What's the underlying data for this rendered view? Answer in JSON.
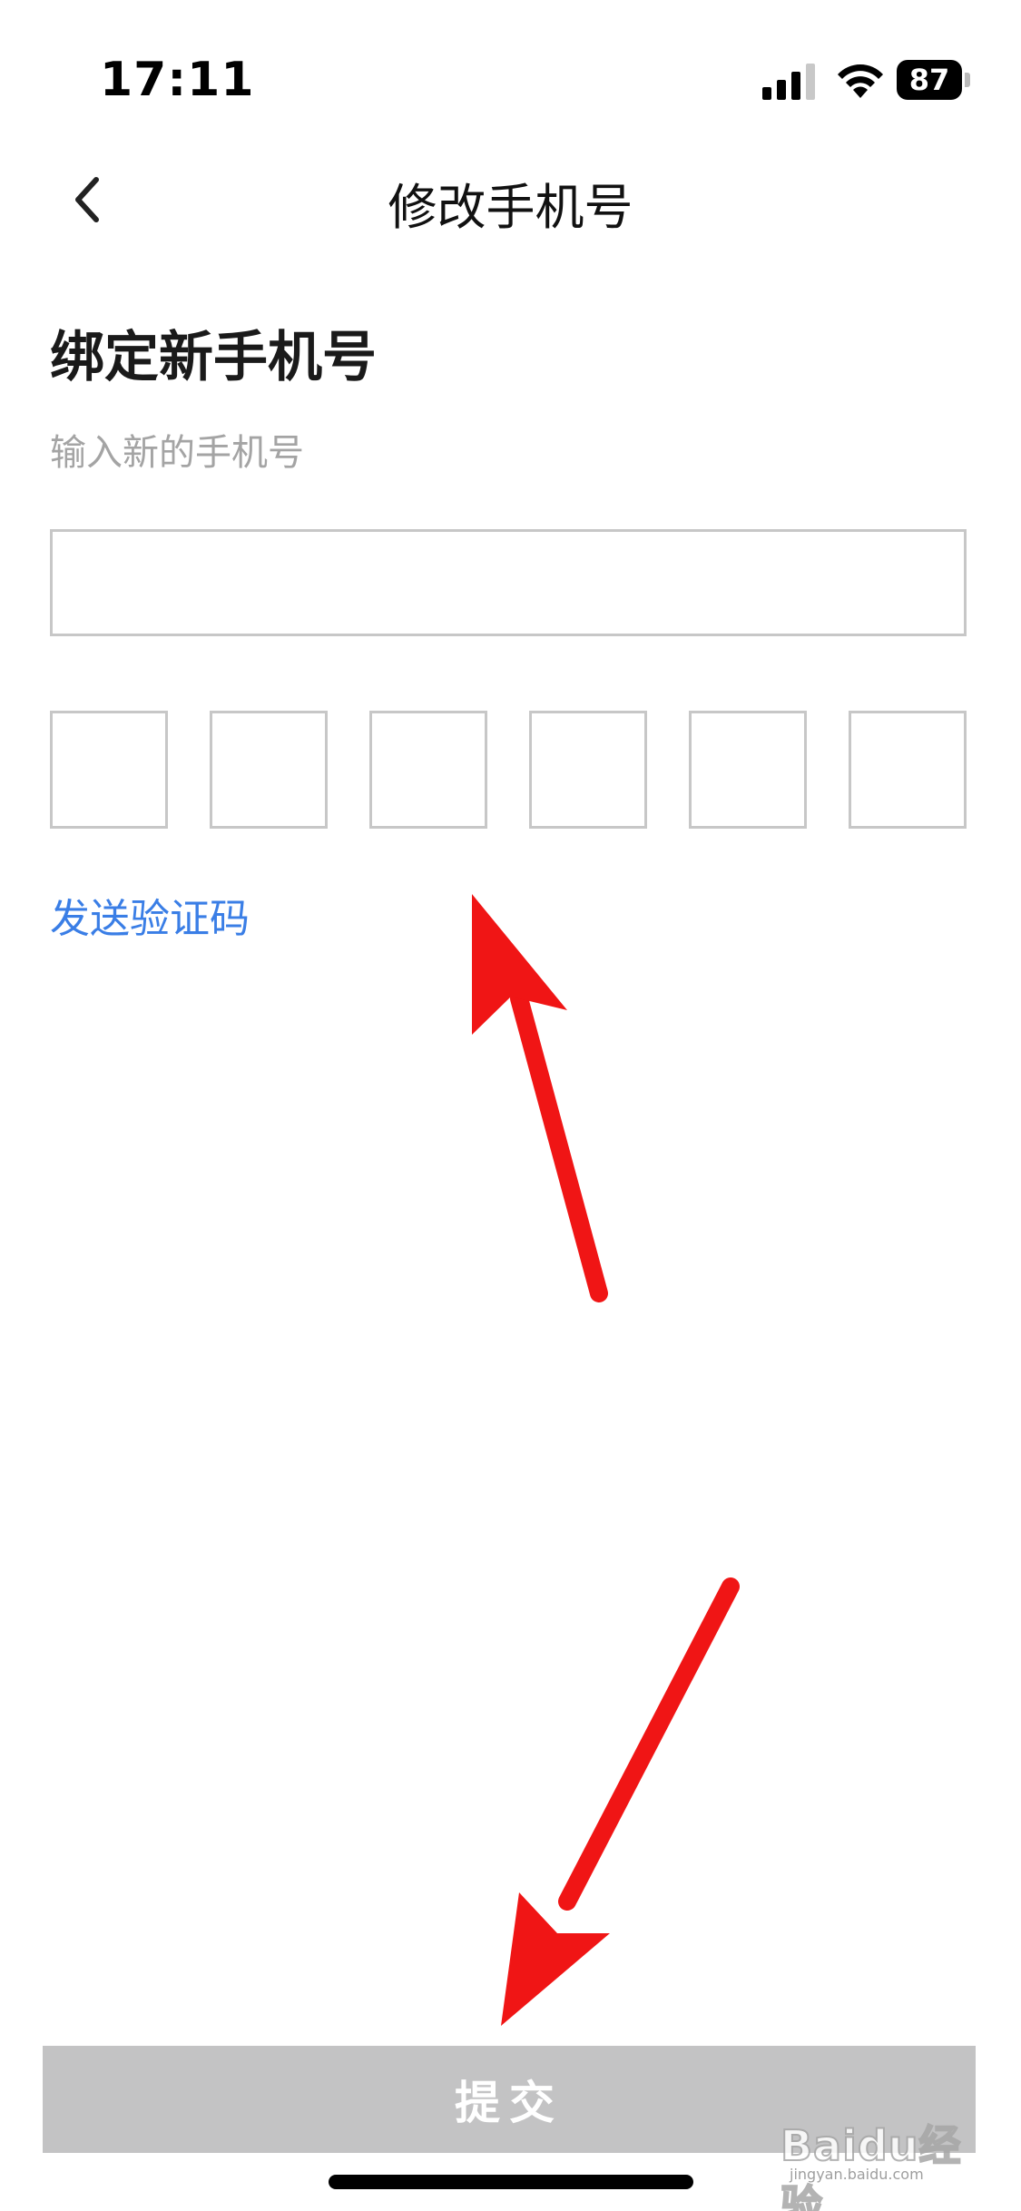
{
  "status_bar": {
    "time": "17:11",
    "battery": "87"
  },
  "nav": {
    "title": "修改手机号",
    "back_icon": "chevron-left-icon"
  },
  "content": {
    "title": "绑定新手机号",
    "subtitle": "输入新的手机号",
    "phone_input_value": "",
    "code_boxes": [
      "",
      "",
      "",
      "",
      "",
      ""
    ],
    "send_code_label": "发送验证码"
  },
  "submit": {
    "label": "提交"
  },
  "watermark": {
    "brand": "Baidu经验",
    "url": "jingyan.baidu.com"
  },
  "colors": {
    "link": "#3a7ee6",
    "submit_bg": "#c3c3c4",
    "box_border": "#c7c7c7",
    "annotation_arrow": "#f01515"
  }
}
